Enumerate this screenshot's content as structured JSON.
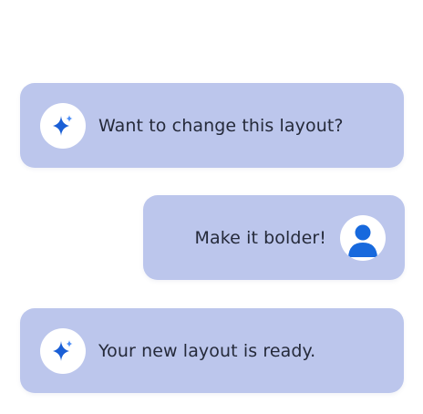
{
  "messages": [
    {
      "role": "assistant",
      "avatar_icon": "sparkle-icon",
      "text": "Want to change this layout?"
    },
    {
      "role": "user",
      "avatar_icon": "user-profile-icon",
      "text": "Make it bolder!"
    },
    {
      "role": "assistant",
      "avatar_icon": "sparkle-icon",
      "text": "Your new layout is ready."
    }
  ],
  "colors": {
    "bubble_background": "#bcc6ec",
    "avatar_background": "#ffffff",
    "text": "#252a3a",
    "sparkle_blue": "#1a5fd6",
    "user_icon_blue": "#1769dd"
  }
}
